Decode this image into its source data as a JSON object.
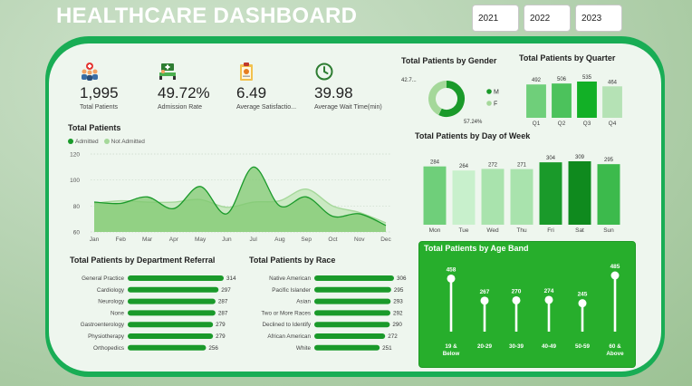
{
  "title": "HEALTHCARE DASHBOARD",
  "years": [
    "2021",
    "2022",
    "2023"
  ],
  "colors": {
    "accent": "#19ad55",
    "dark_green": "#1a9a2a",
    "light_green": "#a5d89a",
    "panel": "#eef6ee"
  },
  "kpis": [
    {
      "icon": "patients-icon",
      "value": "1,995",
      "label": "Total Patients"
    },
    {
      "icon": "admission-icon",
      "value": "49.72%",
      "label": "Admission Rate"
    },
    {
      "icon": "clipboard-icon",
      "value": "6.49",
      "label": "Average Satisfactio..."
    },
    {
      "icon": "clock-icon",
      "value": "39.98",
      "label": "Average Wait Time(min)"
    }
  ],
  "total_patients": {
    "title": "Total Patients",
    "legend": [
      "Admitted",
      "Not Admitted"
    ],
    "months": [
      "Jan",
      "Feb",
      "Mar",
      "Apr",
      "May",
      "Jun",
      "Jul",
      "Aug",
      "Sep",
      "Oct",
      "Nov",
      "Dec"
    ],
    "y_ticks": [
      "120",
      "100",
      "80",
      "60"
    ],
    "ylim": [
      60,
      120
    ],
    "admitted": [
      83,
      82,
      87,
      78,
      95,
      74,
      110,
      80,
      87,
      72,
      74,
      65
    ],
    "not_admitted": [
      82,
      84,
      83,
      83,
      85,
      79,
      83,
      84,
      93,
      80,
      75,
      67
    ]
  },
  "gender": {
    "title": "Total Patients by Gender",
    "labels": [
      "M",
      "F"
    ],
    "values": [
      57.24,
      42.76
    ],
    "value_labels": [
      "57.24%",
      "42.7..."
    ]
  },
  "quarter": {
    "title": "Total Patients by Quarter",
    "categories": [
      "Q1",
      "Q2",
      "Q3",
      "Q4"
    ],
    "values": [
      492,
      506,
      535,
      464
    ]
  },
  "day_of_week": {
    "title": "Total Patients by Day of Week",
    "categories": [
      "Mon",
      "Tue",
      "Wed",
      "Thu",
      "Fri",
      "Sat",
      "Sun"
    ],
    "values": [
      284,
      264,
      272,
      271,
      304,
      309,
      295
    ]
  },
  "department": {
    "title": "Total Patients by Department Referral",
    "categories": [
      "General Practice",
      "Cardiology",
      "Neurology",
      "None",
      "Gastroenterology",
      "Physiotherapy",
      "Orthopedics"
    ],
    "values": [
      314,
      297,
      287,
      287,
      279,
      279,
      256
    ]
  },
  "race": {
    "title": "Total Patients by Race",
    "categories": [
      "Native American",
      "Pacific Islander",
      "Asian",
      "Two or More Races",
      "Declined to Identify",
      "African American",
      "White"
    ],
    "values": [
      306,
      295,
      293,
      292,
      290,
      272,
      251
    ]
  },
  "age_band": {
    "title": "Total Patients by Age Band",
    "categories": [
      "19 & Below",
      "20-29",
      "30-39",
      "40-49",
      "50-59",
      "60 & Above"
    ],
    "cat_lines": [
      [
        "19 &",
        "Below"
      ],
      [
        "20-29"
      ],
      [
        "30-39"
      ],
      [
        "40-49"
      ],
      [
        "50-59"
      ],
      [
        "60 &",
        "Above"
      ]
    ],
    "values": [
      458,
      267,
      270,
      274,
      245,
      485
    ]
  }
}
